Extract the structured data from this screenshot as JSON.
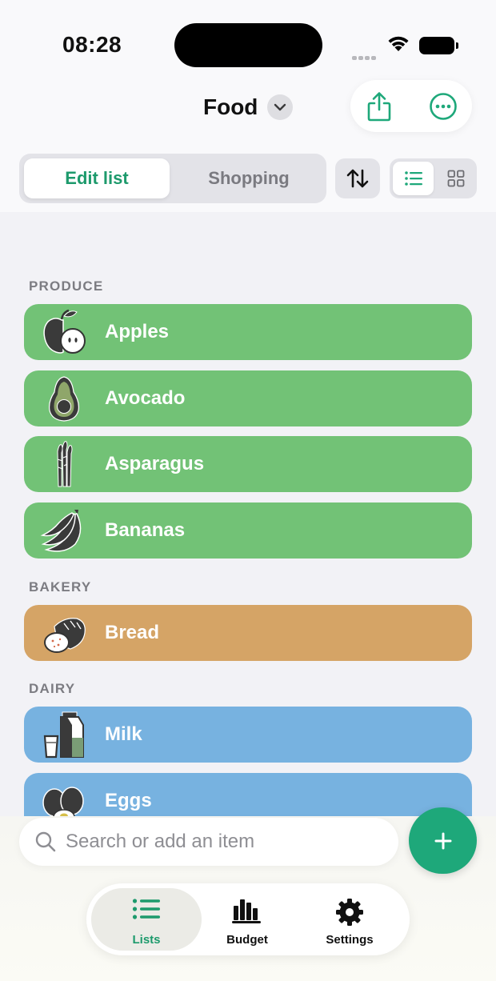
{
  "status_bar": {
    "time": "08:28"
  },
  "header": {
    "title": "Food"
  },
  "segment": {
    "active": "Edit list",
    "inactive": "Shopping"
  },
  "colors": {
    "accent": "#1d9a6c",
    "produce": "#72c276",
    "bakery": "#d5a466",
    "dairy": "#77b2e0"
  },
  "sections": [
    {
      "title": "PRODUCE",
      "items": [
        {
          "label": "Apples",
          "icon": "apple-icon"
        },
        {
          "label": "Avocado",
          "icon": "avocado-icon"
        },
        {
          "label": "Asparagus",
          "icon": "asparagus-icon"
        },
        {
          "label": "Bananas",
          "icon": "banana-icon"
        }
      ]
    },
    {
      "title": "BAKERY",
      "items": [
        {
          "label": "Bread",
          "icon": "bread-icon"
        }
      ]
    },
    {
      "title": "DAIRY",
      "items": [
        {
          "label": "Milk",
          "icon": "milk-icon"
        },
        {
          "label": "Eggs",
          "icon": "eggs-icon"
        }
      ]
    }
  ],
  "search": {
    "placeholder": "Search or add an item"
  },
  "tabs": [
    {
      "label": "Lists",
      "icon": "list-icon",
      "selected": true
    },
    {
      "label": "Budget",
      "icon": "bar-chart-icon",
      "selected": false
    },
    {
      "label": "Settings",
      "icon": "gear-icon",
      "selected": false
    }
  ]
}
